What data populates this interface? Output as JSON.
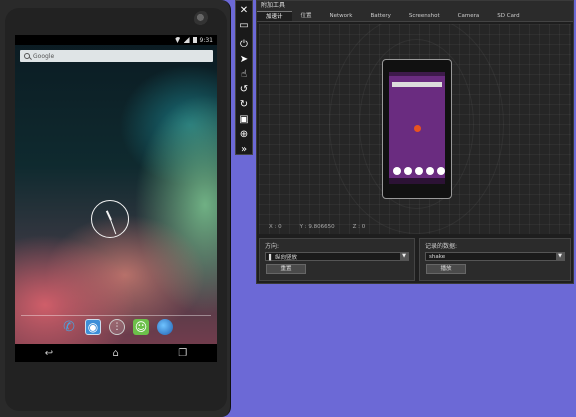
{
  "device": {
    "status_time": "9:31",
    "search_placeholder": "Google",
    "dock_icons": [
      "phone-icon",
      "contacts-icon",
      "apps-icon",
      "messaging-icon",
      "browser-icon"
    ],
    "nav_buttons": [
      "back-icon",
      "home-icon",
      "recents-icon"
    ]
  },
  "toolbar": {
    "buttons": [
      "close-icon",
      "minimize-icon",
      "power-icon",
      "pointer-icon",
      "hand-icon",
      "rotate-left-icon",
      "rotate-right-icon",
      "screenshot-icon",
      "zoom-icon",
      "more-icon"
    ],
    "glyphs": {
      "close": "✕",
      "minimize": "▭",
      "power": "⏻",
      "pointer": "➤",
      "hand": "☝",
      "rotate_left": "↺",
      "rotate_right": "↻",
      "screenshot": "▣",
      "zoom": "⊕",
      "more": "»"
    }
  },
  "tools": {
    "title": "附加工具",
    "tabs": [
      "加速计",
      "位置",
      "Network",
      "Battery",
      "Screenshot",
      "Camera",
      "SD Card"
    ],
    "active_tab": 0,
    "accelerometer": {
      "x": "X : 0",
      "y": "Y : 9.806650",
      "z": "Z : 0"
    },
    "orientation": {
      "label": "方向:",
      "selected": "▌ 纵向竖放",
      "reset_button": "重置"
    },
    "recorded": {
      "label": "记录的数据:",
      "selected": "shake",
      "play_button": "播放"
    }
  },
  "colors": {
    "background": "#6c69d6",
    "mini_screen": "#6a2c80",
    "accel_dot": "#e8531f"
  }
}
